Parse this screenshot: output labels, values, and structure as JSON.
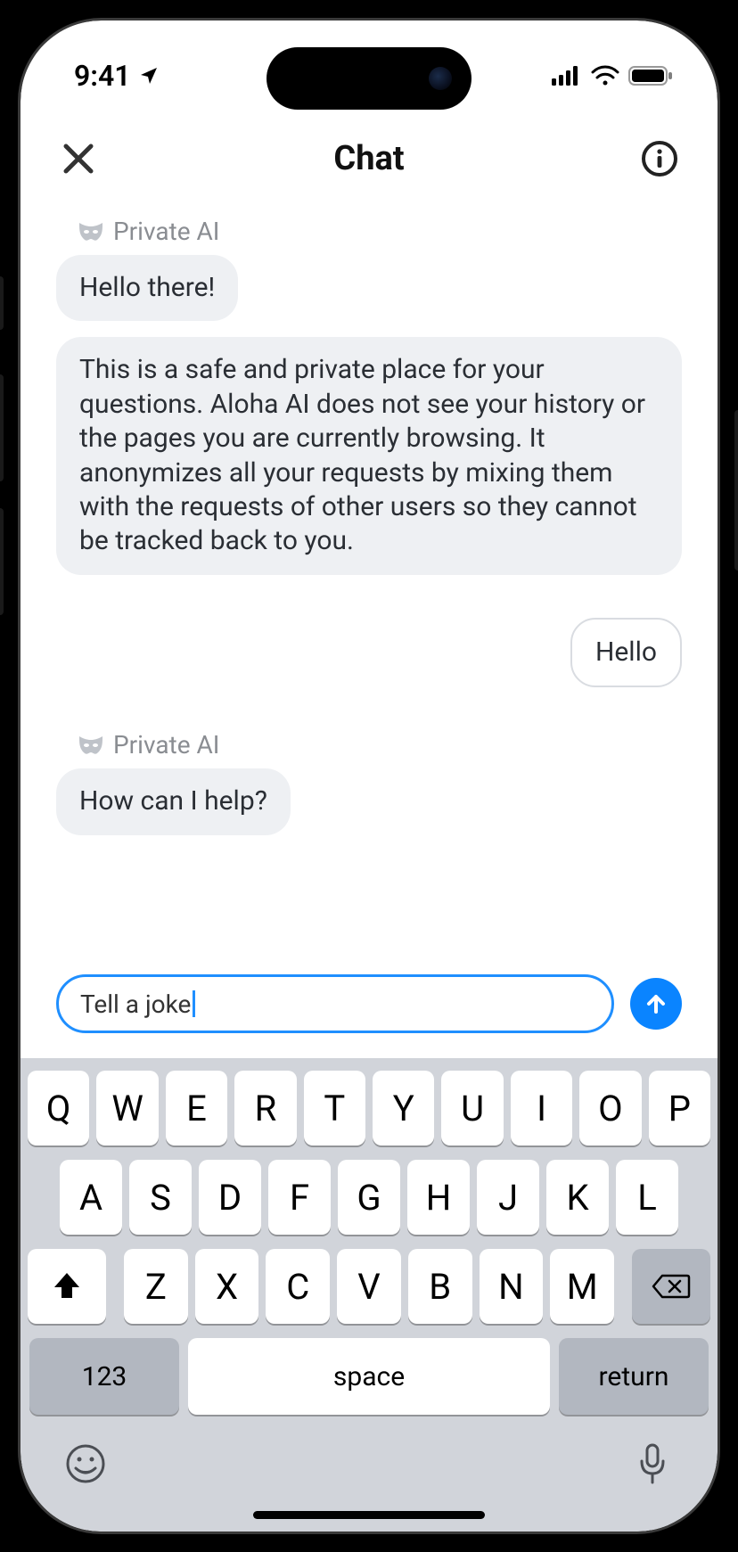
{
  "status": {
    "time": "9:41",
    "location_icon": "location-arrow-icon",
    "signal_icon": "cellular-icon",
    "wifi_icon": "wifi-icon",
    "battery_icon": "battery-icon"
  },
  "header": {
    "close_icon": "close-icon",
    "title": "Chat",
    "info_icon": "info-icon"
  },
  "chat": {
    "ai_name": "Private AI",
    "ai_icon": "mask-icon",
    "messages": [
      {
        "role": "ai",
        "text": "Hello there!"
      },
      {
        "role": "ai",
        "text": "This is a safe and private place for your questions. Aloha AI does not see your history or the pages you are currently browsing. It anonymizes all your requests by mixing them with the requests of other users so they cannot be tracked back to you."
      },
      {
        "role": "user",
        "text": "Hello"
      },
      {
        "role": "ai",
        "text": "How can I help?"
      }
    ]
  },
  "composer": {
    "input_value": "Tell a joke",
    "placeholder": "",
    "send_icon": "arrow-up-icon"
  },
  "keyboard": {
    "row1": [
      "Q",
      "W",
      "E",
      "R",
      "T",
      "Y",
      "U",
      "I",
      "O",
      "P"
    ],
    "row2": [
      "A",
      "S",
      "D",
      "F",
      "G",
      "H",
      "J",
      "K",
      "L"
    ],
    "row3": [
      "Z",
      "X",
      "C",
      "V",
      "B",
      "N",
      "M"
    ],
    "shift_icon": "shift-icon",
    "backspace_icon": "backspace-icon",
    "num_key": "123",
    "space_key": "space",
    "return_key": "return",
    "emoji_icon": "emoji-icon",
    "mic_icon": "mic-icon"
  },
  "colors": {
    "accent": "#0a84ff",
    "input_border": "#1f8fff",
    "ai_bubble_bg": "#eef0f3",
    "user_bubble_border": "#d9dce1",
    "keyboard_bg": "#d1d4da",
    "key_func_bg": "#b2b7c0"
  }
}
